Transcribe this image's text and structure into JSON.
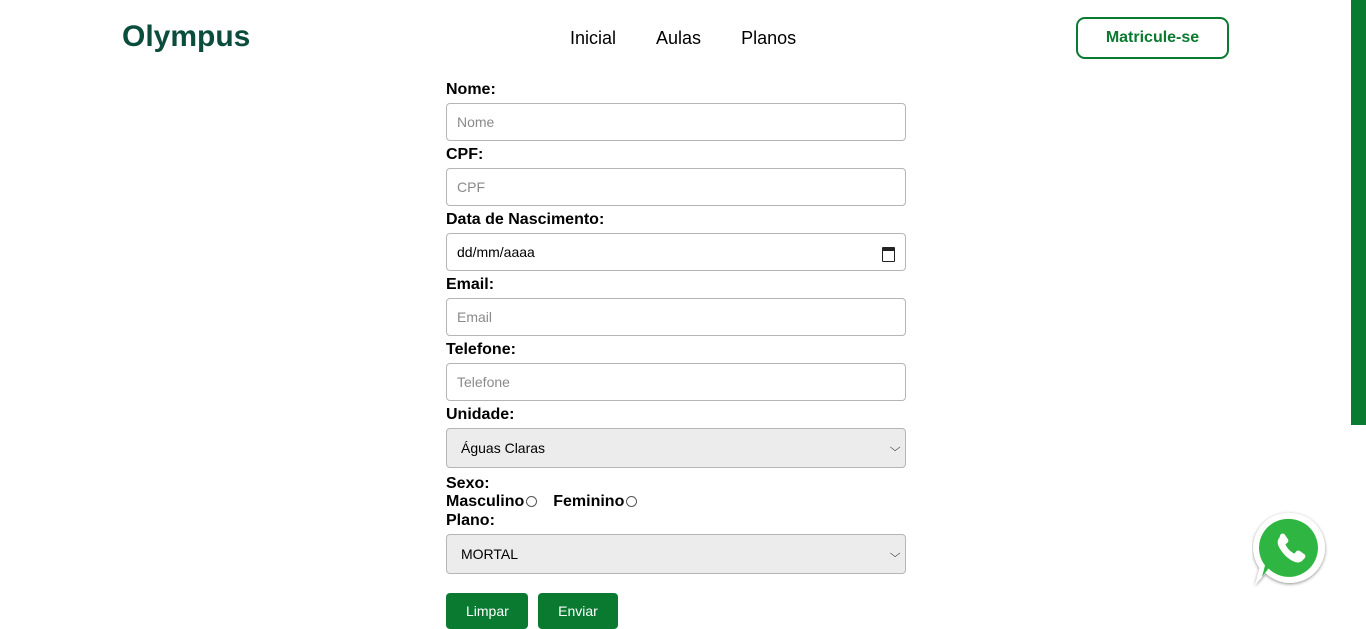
{
  "header": {
    "logo": "Olympus",
    "nav": [
      "Inicial",
      "Aulas",
      "Planos"
    ],
    "cta": "Matricule-se"
  },
  "form": {
    "nome": {
      "label": "Nome:",
      "placeholder": "Nome"
    },
    "cpf": {
      "label": "CPF:",
      "placeholder": "CPF"
    },
    "nascimento": {
      "label": "Data de Nascimento:",
      "value": "dd/mm/aaaa"
    },
    "email": {
      "label": "Email:",
      "placeholder": "Email"
    },
    "telefone": {
      "label": "Telefone:",
      "placeholder": "Telefone"
    },
    "unidade": {
      "label": "Unidade:",
      "value": "Águas Claras"
    },
    "sexo": {
      "label": "Sexo:",
      "options": [
        "Masculino",
        "Feminino"
      ]
    },
    "plano": {
      "label": "Plano:",
      "value": "MORTAL"
    },
    "buttons": {
      "clear": "Limpar",
      "submit": "Enviar"
    }
  },
  "colors": {
    "brand": "#0b4d3c",
    "accent": "#0a7a30",
    "whatsapp": "#25d366"
  },
  "icons": {
    "floating": "whatsapp-icon",
    "date": "calendar-icon",
    "select": "chevron-down-icon"
  }
}
